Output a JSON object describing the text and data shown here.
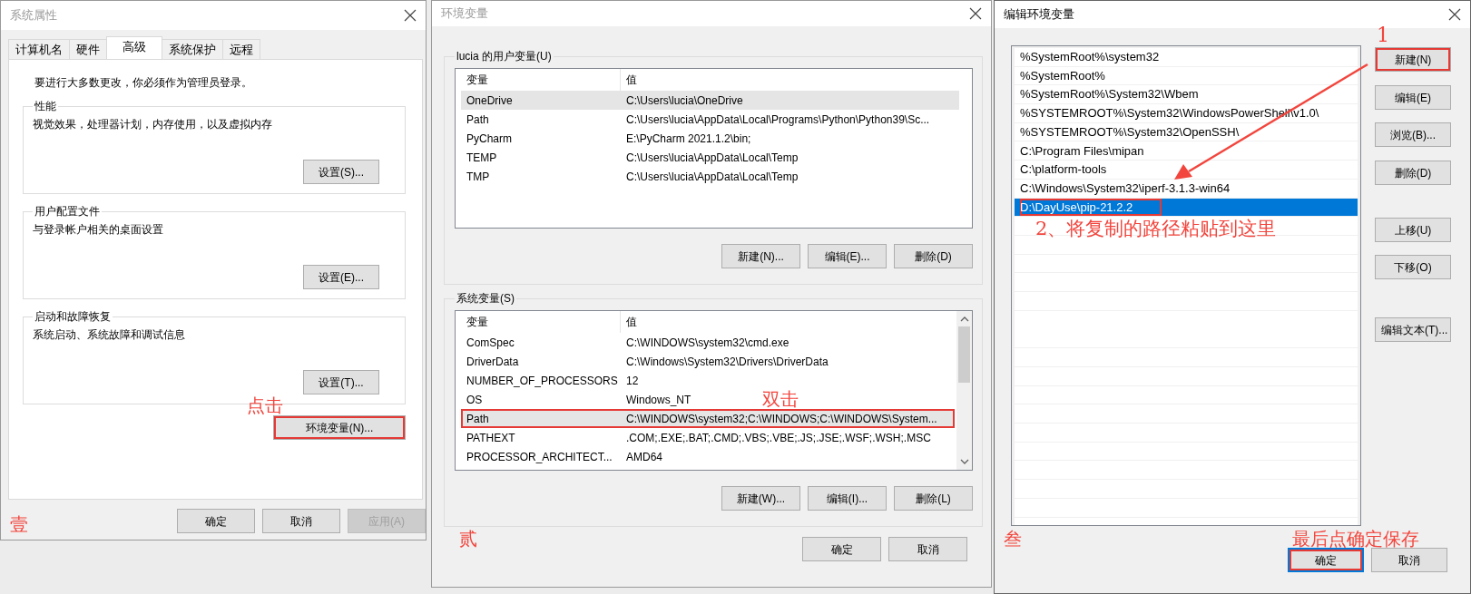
{
  "system_properties": {
    "title": "系统属性",
    "tabs": [
      {
        "label": "计算机名",
        "selected": false
      },
      {
        "label": "硬件",
        "selected": false
      },
      {
        "label": "高级",
        "selected": true
      },
      {
        "label": "系统保护",
        "selected": false
      },
      {
        "label": "远程",
        "selected": false
      }
    ],
    "notice": "要进行大多数更改，你必须作为管理员登录。",
    "groups": [
      {
        "legend": "性能",
        "description": "视觉效果，处理器计划，内存使用，以及虚拟内存",
        "button": "设置(S)..."
      },
      {
        "legend": "用户配置文件",
        "description": "与登录帐户相关的桌面设置",
        "button": "设置(E)..."
      },
      {
        "legend": "启动和故障恢复",
        "description": "系统启动、系统故障和调试信息",
        "button": "设置(T)..."
      }
    ],
    "env_button": {
      "label": "环境变量(N)...",
      "highlighted": true
    },
    "hint": "点击",
    "step": "壹",
    "buttons": [
      {
        "label": "确定",
        "disabled": false
      },
      {
        "label": "取消",
        "disabled": false
      },
      {
        "label": "应用(A)",
        "disabled": true
      }
    ]
  },
  "environment_variables": {
    "title": "环境变量",
    "groups": [
      {
        "legend": "lucia 的用户变量(U)",
        "columns": [
          "变量",
          "值"
        ],
        "scrollbar": false,
        "rows": [
          {
            "name": "OneDrive",
            "value": "C:\\Users\\lucia\\OneDrive",
            "selected": true,
            "highlighted": false
          },
          {
            "name": "Path",
            "value": "C:\\Users\\lucia\\AppData\\Local\\Programs\\Python\\Python39\\Sc...",
            "selected": false,
            "highlighted": false
          },
          {
            "name": "PyCharm",
            "value": "E:\\PyCharm 2021.1.2\\bin;",
            "selected": false,
            "highlighted": false
          },
          {
            "name": "TEMP",
            "value": "C:\\Users\\lucia\\AppData\\Local\\Temp",
            "selected": false,
            "highlighted": false
          },
          {
            "name": "TMP",
            "value": "C:\\Users\\lucia\\AppData\\Local\\Temp",
            "selected": false,
            "highlighted": false
          }
        ],
        "buttons": [
          "新建(N)...",
          "编辑(E)...",
          "删除(D)"
        ]
      },
      {
        "legend": "系统变量(S)",
        "columns": [
          "变量",
          "值"
        ],
        "scrollbar": true,
        "rows": [
          {
            "name": "ComSpec",
            "value": "C:\\WINDOWS\\system32\\cmd.exe",
            "selected": false,
            "highlighted": false
          },
          {
            "name": "DriverData",
            "value": "C:\\Windows\\System32\\Drivers\\DriverData",
            "selected": false,
            "highlighted": false
          },
          {
            "name": "NUMBER_OF_PROCESSORS",
            "value": "12",
            "selected": false,
            "highlighted": false
          },
          {
            "name": "OS",
            "value": "Windows_NT",
            "selected": false,
            "highlighted": false
          },
          {
            "name": "Path",
            "value": "C:\\WINDOWS\\system32;C:\\WINDOWS;C:\\WINDOWS\\System...",
            "selected": true,
            "highlighted": true
          },
          {
            "name": "PATHEXT",
            "value": ".COM;.EXE;.BAT;.CMD;.VBS;.VBE;.JS;.JSE;.WSF;.WSH;.MSC",
            "selected": false,
            "highlighted": false
          },
          {
            "name": "PROCESSOR_ARCHITECT...",
            "value": "AMD64",
            "selected": false,
            "highlighted": false
          }
        ],
        "buttons": [
          "新建(W)...",
          "编辑(I)...",
          "删除(L)"
        ]
      }
    ],
    "hint": "双击",
    "step": "贰",
    "buttons": [
      "确定",
      "取消"
    ]
  },
  "edit_environment_variable": {
    "title": "编辑环境变量",
    "entries": [
      {
        "text": "%SystemRoot%\\system32",
        "selected": false,
        "highlighted": false
      },
      {
        "text": "%SystemRoot%",
        "selected": false,
        "highlighted": false
      },
      {
        "text": "%SystemRoot%\\System32\\Wbem",
        "selected": false,
        "highlighted": false
      },
      {
        "text": "%SYSTEMROOT%\\System32\\WindowsPowerShell\\v1.0\\",
        "selected": false,
        "highlighted": false
      },
      {
        "text": "%SYSTEMROOT%\\System32\\OpenSSH\\",
        "selected": false,
        "highlighted": false
      },
      {
        "text": "C:\\Program Files\\mipan",
        "selected": false,
        "highlighted": false
      },
      {
        "text": "C:\\platform-tools",
        "selected": false,
        "highlighted": false
      },
      {
        "text": "C:\\Windows\\System32\\iperf-3.1.3-win64",
        "selected": false,
        "highlighted": false
      },
      {
        "text": "D:\\DayUse\\pip-21.2.2",
        "selected": true,
        "highlighted": true
      }
    ],
    "side_buttons": [
      {
        "label": "新建(N)",
        "highlighted": true
      },
      {
        "label": "编辑(E)",
        "highlighted": false
      },
      {
        "label": "浏览(B)...",
        "highlighted": false
      },
      {
        "label": "删除(D)",
        "highlighted": false
      },
      {
        "label": "上移(U)",
        "highlighted": false
      },
      {
        "label": "下移(O)",
        "highlighted": false
      },
      {
        "label": "编辑文本(T)...",
        "highlighted": false
      }
    ],
    "hints": [
      "1",
      "2、将复制的路径粘贴到这里",
      "最后点确定保存"
    ],
    "step": "叁",
    "buttons": [
      {
        "label": "确定",
        "default": true,
        "highlighted": true
      },
      {
        "label": "取消",
        "default": false,
        "highlighted": false
      }
    ]
  }
}
